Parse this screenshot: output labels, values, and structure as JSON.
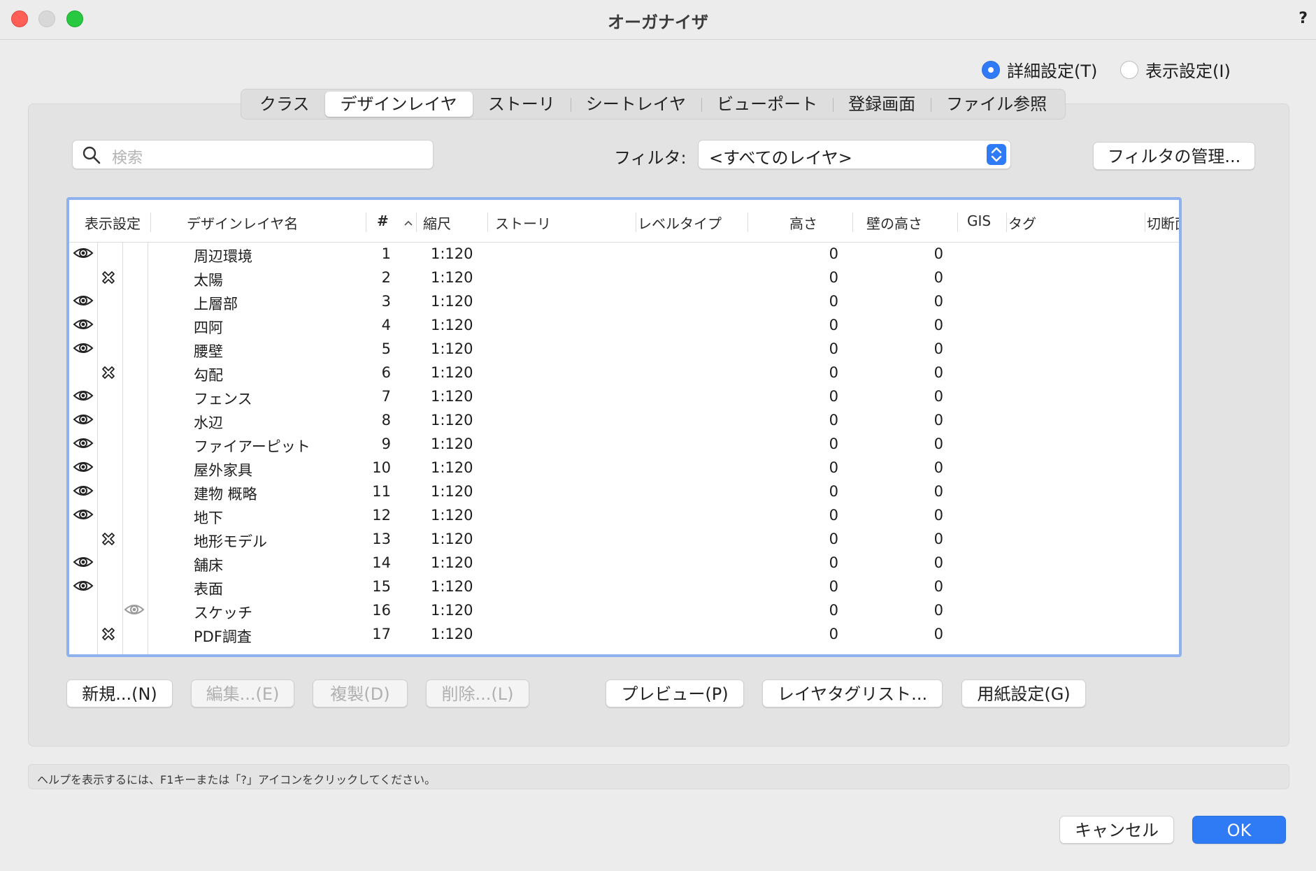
{
  "window": {
    "title": "オーガナイザ",
    "help": "?"
  },
  "mode": {
    "options": [
      {
        "label": "詳細設定(T)",
        "selected": true
      },
      {
        "label": "表示設定(I)",
        "selected": false
      }
    ]
  },
  "tabs": [
    {
      "label": "クラス",
      "active": false
    },
    {
      "label": "デザインレイヤ",
      "active": true
    },
    {
      "label": "ストーリ",
      "active": false
    },
    {
      "label": "シートレイヤ",
      "active": false
    },
    {
      "label": "ビューポート",
      "active": false
    },
    {
      "label": "登録画面",
      "active": false
    },
    {
      "label": "ファイル参照",
      "active": false
    }
  ],
  "search": {
    "placeholder": "検索"
  },
  "filter": {
    "label": "フィルタ:",
    "value": "<すべてのレイヤ>",
    "manage_label": "フィルタの管理..."
  },
  "table": {
    "columns": {
      "visibility": "表示設定",
      "name": "デザインレイヤ名",
      "number": "#",
      "scale": "縮尺",
      "story": "ストーリ",
      "level_type": "レベルタイプ",
      "height": "高さ",
      "wall_height": "壁の高さ",
      "gis": "GIS",
      "tag": "タグ",
      "cut_plane": "切断面"
    },
    "sort": {
      "column": "#",
      "direction": "ascending"
    },
    "rows": [
      {
        "visibility": "visible",
        "name": "周辺環境",
        "number": "1",
        "scale": "1:120",
        "height": "0",
        "wall_height": "0"
      },
      {
        "visibility": "hidden",
        "name": "太陽",
        "number": "2",
        "scale": "1:120",
        "height": "0",
        "wall_height": "0"
      },
      {
        "visibility": "visible",
        "name": "上層部",
        "number": "3",
        "scale": "1:120",
        "height": "0",
        "wall_height": "0"
      },
      {
        "visibility": "visible",
        "name": "四阿",
        "number": "4",
        "scale": "1:120",
        "height": "0",
        "wall_height": "0"
      },
      {
        "visibility": "visible",
        "name": "腰壁",
        "number": "5",
        "scale": "1:120",
        "height": "0",
        "wall_height": "0"
      },
      {
        "visibility": "hidden",
        "name": "勾配",
        "number": "6",
        "scale": "1:120",
        "height": "0",
        "wall_height": "0"
      },
      {
        "visibility": "visible",
        "name": "フェンス",
        "number": "7",
        "scale": "1:120",
        "height": "0",
        "wall_height": "0"
      },
      {
        "visibility": "visible",
        "name": "水辺",
        "number": "8",
        "scale": "1:120",
        "height": "0",
        "wall_height": "0"
      },
      {
        "visibility": "visible",
        "name": "ファイアーピット",
        "number": "9",
        "scale": "1:120",
        "height": "0",
        "wall_height": "0"
      },
      {
        "visibility": "visible",
        "name": "屋外家具",
        "number": "10",
        "scale": "1:120",
        "height": "0",
        "wall_height": "0"
      },
      {
        "visibility": "visible",
        "name": "建物 概略",
        "number": "11",
        "scale": "1:120",
        "height": "0",
        "wall_height": "0"
      },
      {
        "visibility": "visible",
        "name": "地下",
        "number": "12",
        "scale": "1:120",
        "height": "0",
        "wall_height": "0"
      },
      {
        "visibility": "hidden",
        "name": "地形モデル",
        "number": "13",
        "scale": "1:120",
        "height": "0",
        "wall_height": "0"
      },
      {
        "visibility": "visible",
        "name": "舗床",
        "number": "14",
        "scale": "1:120",
        "height": "0",
        "wall_height": "0"
      },
      {
        "visibility": "visible",
        "name": "表面",
        "number": "15",
        "scale": "1:120",
        "height": "0",
        "wall_height": "0"
      },
      {
        "visibility": "grayed",
        "name": "スケッチ",
        "number": "16",
        "scale": "1:120",
        "height": "0",
        "wall_height": "0"
      },
      {
        "visibility": "hidden",
        "name": "PDF調査",
        "number": "17",
        "scale": "1:120",
        "height": "0",
        "wall_height": "0"
      }
    ]
  },
  "actions": {
    "new": {
      "label": "新規...(N)",
      "enabled": true
    },
    "edit": {
      "label": "編集...(E)",
      "enabled": false
    },
    "duplicate": {
      "label": "複製(D)",
      "enabled": false
    },
    "delete": {
      "label": "削除...(L)",
      "enabled": false
    },
    "preview": {
      "label": "プレビュー(P)",
      "enabled": true
    },
    "tag_list": {
      "label": "レイヤタグリスト...",
      "enabled": true
    },
    "page_setup": {
      "label": "用紙設定(G)",
      "enabled": true
    }
  },
  "help_text": "ヘルプを表示するには、F1キーまたは「?」アイコンをクリックしてください。",
  "dialog": {
    "cancel": "キャンセル",
    "ok": "OK"
  },
  "colors": {
    "accent": "#2f7bf5",
    "table_border": "#8fb1ee",
    "close": "#ff5f57",
    "maximize": "#28c840"
  }
}
